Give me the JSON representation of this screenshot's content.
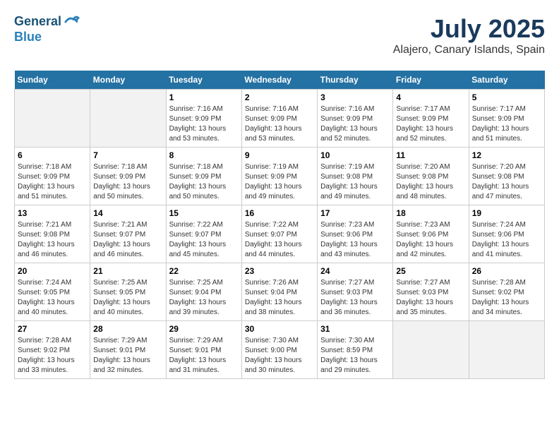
{
  "logo": {
    "line1": "General",
    "line2": "Blue"
  },
  "title": "July 2025",
  "location": "Alajero, Canary Islands, Spain",
  "days_header": [
    "Sunday",
    "Monday",
    "Tuesday",
    "Wednesday",
    "Thursday",
    "Friday",
    "Saturday"
  ],
  "weeks": [
    [
      {
        "day": "",
        "sunrise": "",
        "sunset": "",
        "daylight": ""
      },
      {
        "day": "",
        "sunrise": "",
        "sunset": "",
        "daylight": ""
      },
      {
        "day": "1",
        "sunrise": "Sunrise: 7:16 AM",
        "sunset": "Sunset: 9:09 PM",
        "daylight": "Daylight: 13 hours and 53 minutes."
      },
      {
        "day": "2",
        "sunrise": "Sunrise: 7:16 AM",
        "sunset": "Sunset: 9:09 PM",
        "daylight": "Daylight: 13 hours and 53 minutes."
      },
      {
        "day": "3",
        "sunrise": "Sunrise: 7:16 AM",
        "sunset": "Sunset: 9:09 PM",
        "daylight": "Daylight: 13 hours and 52 minutes."
      },
      {
        "day": "4",
        "sunrise": "Sunrise: 7:17 AM",
        "sunset": "Sunset: 9:09 PM",
        "daylight": "Daylight: 13 hours and 52 minutes."
      },
      {
        "day": "5",
        "sunrise": "Sunrise: 7:17 AM",
        "sunset": "Sunset: 9:09 PM",
        "daylight": "Daylight: 13 hours and 51 minutes."
      }
    ],
    [
      {
        "day": "6",
        "sunrise": "Sunrise: 7:18 AM",
        "sunset": "Sunset: 9:09 PM",
        "daylight": "Daylight: 13 hours and 51 minutes."
      },
      {
        "day": "7",
        "sunrise": "Sunrise: 7:18 AM",
        "sunset": "Sunset: 9:09 PM",
        "daylight": "Daylight: 13 hours and 50 minutes."
      },
      {
        "day": "8",
        "sunrise": "Sunrise: 7:18 AM",
        "sunset": "Sunset: 9:09 PM",
        "daylight": "Daylight: 13 hours and 50 minutes."
      },
      {
        "day": "9",
        "sunrise": "Sunrise: 7:19 AM",
        "sunset": "Sunset: 9:09 PM",
        "daylight": "Daylight: 13 hours and 49 minutes."
      },
      {
        "day": "10",
        "sunrise": "Sunrise: 7:19 AM",
        "sunset": "Sunset: 9:08 PM",
        "daylight": "Daylight: 13 hours and 49 minutes."
      },
      {
        "day": "11",
        "sunrise": "Sunrise: 7:20 AM",
        "sunset": "Sunset: 9:08 PM",
        "daylight": "Daylight: 13 hours and 48 minutes."
      },
      {
        "day": "12",
        "sunrise": "Sunrise: 7:20 AM",
        "sunset": "Sunset: 9:08 PM",
        "daylight": "Daylight: 13 hours and 47 minutes."
      }
    ],
    [
      {
        "day": "13",
        "sunrise": "Sunrise: 7:21 AM",
        "sunset": "Sunset: 9:08 PM",
        "daylight": "Daylight: 13 hours and 46 minutes."
      },
      {
        "day": "14",
        "sunrise": "Sunrise: 7:21 AM",
        "sunset": "Sunset: 9:07 PM",
        "daylight": "Daylight: 13 hours and 46 minutes."
      },
      {
        "day": "15",
        "sunrise": "Sunrise: 7:22 AM",
        "sunset": "Sunset: 9:07 PM",
        "daylight": "Daylight: 13 hours and 45 minutes."
      },
      {
        "day": "16",
        "sunrise": "Sunrise: 7:22 AM",
        "sunset": "Sunset: 9:07 PM",
        "daylight": "Daylight: 13 hours and 44 minutes."
      },
      {
        "day": "17",
        "sunrise": "Sunrise: 7:23 AM",
        "sunset": "Sunset: 9:06 PM",
        "daylight": "Daylight: 13 hours and 43 minutes."
      },
      {
        "day": "18",
        "sunrise": "Sunrise: 7:23 AM",
        "sunset": "Sunset: 9:06 PM",
        "daylight": "Daylight: 13 hours and 42 minutes."
      },
      {
        "day": "19",
        "sunrise": "Sunrise: 7:24 AM",
        "sunset": "Sunset: 9:06 PM",
        "daylight": "Daylight: 13 hours and 41 minutes."
      }
    ],
    [
      {
        "day": "20",
        "sunrise": "Sunrise: 7:24 AM",
        "sunset": "Sunset: 9:05 PM",
        "daylight": "Daylight: 13 hours and 40 minutes."
      },
      {
        "day": "21",
        "sunrise": "Sunrise: 7:25 AM",
        "sunset": "Sunset: 9:05 PM",
        "daylight": "Daylight: 13 hours and 40 minutes."
      },
      {
        "day": "22",
        "sunrise": "Sunrise: 7:25 AM",
        "sunset": "Sunset: 9:04 PM",
        "daylight": "Daylight: 13 hours and 39 minutes."
      },
      {
        "day": "23",
        "sunrise": "Sunrise: 7:26 AM",
        "sunset": "Sunset: 9:04 PM",
        "daylight": "Daylight: 13 hours and 38 minutes."
      },
      {
        "day": "24",
        "sunrise": "Sunrise: 7:27 AM",
        "sunset": "Sunset: 9:03 PM",
        "daylight": "Daylight: 13 hours and 36 minutes."
      },
      {
        "day": "25",
        "sunrise": "Sunrise: 7:27 AM",
        "sunset": "Sunset: 9:03 PM",
        "daylight": "Daylight: 13 hours and 35 minutes."
      },
      {
        "day": "26",
        "sunrise": "Sunrise: 7:28 AM",
        "sunset": "Sunset: 9:02 PM",
        "daylight": "Daylight: 13 hours and 34 minutes."
      }
    ],
    [
      {
        "day": "27",
        "sunrise": "Sunrise: 7:28 AM",
        "sunset": "Sunset: 9:02 PM",
        "daylight": "Daylight: 13 hours and 33 minutes."
      },
      {
        "day": "28",
        "sunrise": "Sunrise: 7:29 AM",
        "sunset": "Sunset: 9:01 PM",
        "daylight": "Daylight: 13 hours and 32 minutes."
      },
      {
        "day": "29",
        "sunrise": "Sunrise: 7:29 AM",
        "sunset": "Sunset: 9:01 PM",
        "daylight": "Daylight: 13 hours and 31 minutes."
      },
      {
        "day": "30",
        "sunrise": "Sunrise: 7:30 AM",
        "sunset": "Sunset: 9:00 PM",
        "daylight": "Daylight: 13 hours and 30 minutes."
      },
      {
        "day": "31",
        "sunrise": "Sunrise: 7:30 AM",
        "sunset": "Sunset: 8:59 PM",
        "daylight": "Daylight: 13 hours and 29 minutes."
      },
      {
        "day": "",
        "sunrise": "",
        "sunset": "",
        "daylight": ""
      },
      {
        "day": "",
        "sunrise": "",
        "sunset": "",
        "daylight": ""
      }
    ]
  ]
}
